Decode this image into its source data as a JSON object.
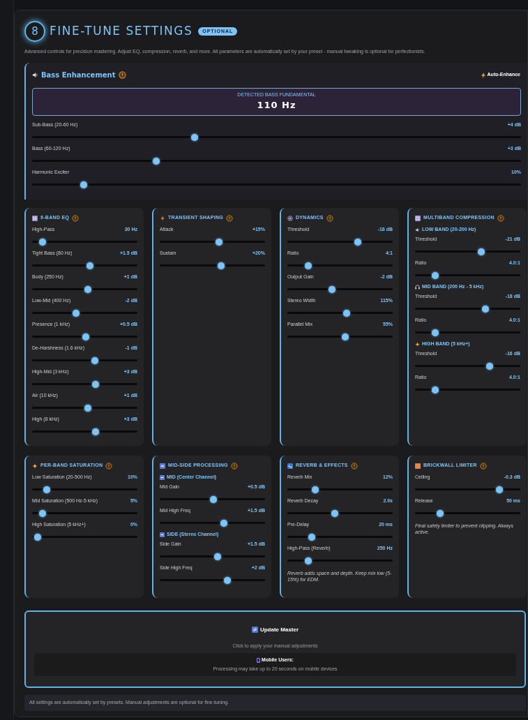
{
  "header": {
    "step": "8",
    "title": "FINE-TUNE SETTINGS",
    "badge": "OPTIONAL"
  },
  "description": "Advanced controls for precision mastering. Adjust EQ, compression, reverb, and more. All parameters are automatically set by your preset - manual tweaking is optional for perfectionists.",
  "bass": {
    "title": "Bass Enhancement",
    "auto_button": "Auto-Enhance",
    "detected_label": "DETECTED BASS FUNDAMENTAL",
    "detected_value": "110 Hz",
    "sliders": [
      {
        "label": "Sub-Bass (20-60 Hz)",
        "value": "+4 dB",
        "level": 0.33
      },
      {
        "label": "Bass (60-120 Hz)",
        "value": "+3 dB",
        "level": 0.25
      },
      {
        "label": "Harmonic Exciter",
        "value": "10%",
        "level": 0.1
      }
    ]
  },
  "panel_rows": [
    [
      {
        "title": "9-BAND EQ",
        "items": [
          {
            "kind": "slider",
            "label": "High-Pass",
            "value": "30 Hz",
            "level": 0.07
          },
          {
            "kind": "slider",
            "label": "Tight Bass (80 Hz)",
            "value": "+1.5 dB",
            "level": 0.55
          },
          {
            "kind": "slider",
            "label": "Body (250 Hz)",
            "value": "+1 dB",
            "level": 0.53
          },
          {
            "kind": "slider",
            "label": "Low-Mid (400 Hz)",
            "value": "-2 dB",
            "level": 0.41
          },
          {
            "kind": "slider",
            "label": "Presence (1 kHz)",
            "value": "+0.5 dB",
            "level": 0.51
          },
          {
            "kind": "slider",
            "label": "De-Harshness (1.6 kHz)",
            "value": "-1 dB",
            "level": 0.6
          },
          {
            "kind": "slider",
            "label": "High-Mid (3 kHz)",
            "value": "+3 dB",
            "level": 0.61
          },
          {
            "kind": "slider",
            "label": "Air (10 kHz)",
            "value": "+1 dB",
            "level": 0.53
          },
          {
            "kind": "slider",
            "label": "High (8 kHz)",
            "value": "+3 dB",
            "level": 0.61
          }
        ]
      },
      {
        "title": "TRANSIENT SHAPING",
        "items": [
          {
            "kind": "slider",
            "label": "Attack",
            "value": "+15%",
            "level": 0.57
          },
          {
            "kind": "slider",
            "label": "Sustain",
            "value": "+20%",
            "level": 0.59
          }
        ]
      },
      {
        "title": "DYNAMICS",
        "items": [
          {
            "kind": "slider",
            "label": "Threshold",
            "value": "-18 dB",
            "level": 0.68
          },
          {
            "kind": "slider",
            "label": "Ratio",
            "value": "4:1",
            "level": 0.18
          },
          {
            "kind": "slider",
            "label": "Output Gain",
            "value": "-2 dB",
            "level": 0.42
          },
          {
            "kind": "slider",
            "label": "Stereo Width",
            "value": "115%",
            "level": 0.57
          },
          {
            "kind": "slider",
            "label": "Parallel Mix",
            "value": "55%",
            "level": 0.55
          }
        ]
      },
      {
        "title": "MULTIBAND COMPRESSION",
        "items": [
          {
            "kind": "subheading",
            "label": "LOW BAND (20-200 Hz)"
          },
          {
            "kind": "slider",
            "label": "Threshold",
            "value": "-21 dB",
            "level": 0.64
          },
          {
            "kind": "slider",
            "label": "Ratio",
            "value": "4.0:1",
            "level": 0.17
          },
          {
            "kind": "subheading",
            "label": "MID BAND (200 Hz - 5 kHz)"
          },
          {
            "kind": "slider",
            "label": "Threshold",
            "value": "-18 dB",
            "level": 0.68
          },
          {
            "kind": "slider",
            "label": "Ratio",
            "value": "4.0:1",
            "level": 0.17
          },
          {
            "kind": "subheading",
            "label": "HIGH BAND (5 kHz+)"
          },
          {
            "kind": "slider",
            "label": "Threshold",
            "value": "-16 dB",
            "level": 0.72
          },
          {
            "kind": "slider",
            "label": "Ratio",
            "value": "4.0:1",
            "level": 0.17
          }
        ]
      }
    ],
    [
      {
        "title": "PER-BAND SATURATION",
        "items": [
          {
            "kind": "slider",
            "label": "Low Saturation (20-500 Hz)",
            "value": "10%",
            "level": 0.11
          },
          {
            "kind": "slider",
            "label": "Mid Saturation (500 Hz-5 kHz)",
            "value": "5%",
            "level": 0.07
          },
          {
            "kind": "slider",
            "label": "High Saturation (5 kHz+)",
            "value": "0%",
            "level": 0.02
          }
        ]
      },
      {
        "title": "MID-SIDE PROCESSING",
        "items": [
          {
            "kind": "subheading",
            "label": "MID (Center Channel)"
          },
          {
            "kind": "slider",
            "label": "Mid Gain",
            "value": "+0.5 dB",
            "level": 0.51
          },
          {
            "kind": "slider",
            "label": "Mid High Freq",
            "value": "+1.5 dB",
            "level": 0.62
          },
          {
            "kind": "subheading",
            "label": "SIDE (Stereo Channel)"
          },
          {
            "kind": "slider",
            "label": "Side Gain",
            "value": "+1.5 dB",
            "level": 0.55
          },
          {
            "kind": "slider",
            "label": "Side High Freq",
            "value": "+2 dB",
            "level": 0.65
          }
        ]
      },
      {
        "title": "REVERB & EFFECTS",
        "items": [
          {
            "kind": "slider",
            "label": "Reverb Mix",
            "value": "12%",
            "level": 0.25
          },
          {
            "kind": "slider",
            "label": "Reverb Decay",
            "value": "2.0s",
            "level": 0.45
          },
          {
            "kind": "slider",
            "label": "Pre-Delay",
            "value": "20 ms",
            "level": 0.21
          },
          {
            "kind": "slider",
            "label": "High-Pass (Reverb)",
            "value": "250 Hz",
            "level": 0.18
          },
          {
            "kind": "note",
            "label": "Reverb adds space and depth. Keep mix low (5-15%) for EDM."
          }
        ]
      },
      {
        "title": "BRICKWALL LIMITER",
        "items": [
          {
            "kind": "slider",
            "label": "Ceiling",
            "value": "-0.3 dB",
            "level": 0.82
          },
          {
            "kind": "slider",
            "label": "Release",
            "value": "50 ms",
            "level": 0.22
          },
          {
            "kind": "note",
            "label": "Final safety limiter to prevent clipping. Always active."
          }
        ]
      }
    ]
  ],
  "update": {
    "button": "Update Master",
    "hint": "Click to apply your manual adjustments",
    "mobile_title": "Mobile Users:",
    "mobile_text": "Processing may take up to 20 seconds on mobile devices"
  },
  "footer": "All settings are automatically set by presets. Manual adjustments are optional for fine-tuning."
}
